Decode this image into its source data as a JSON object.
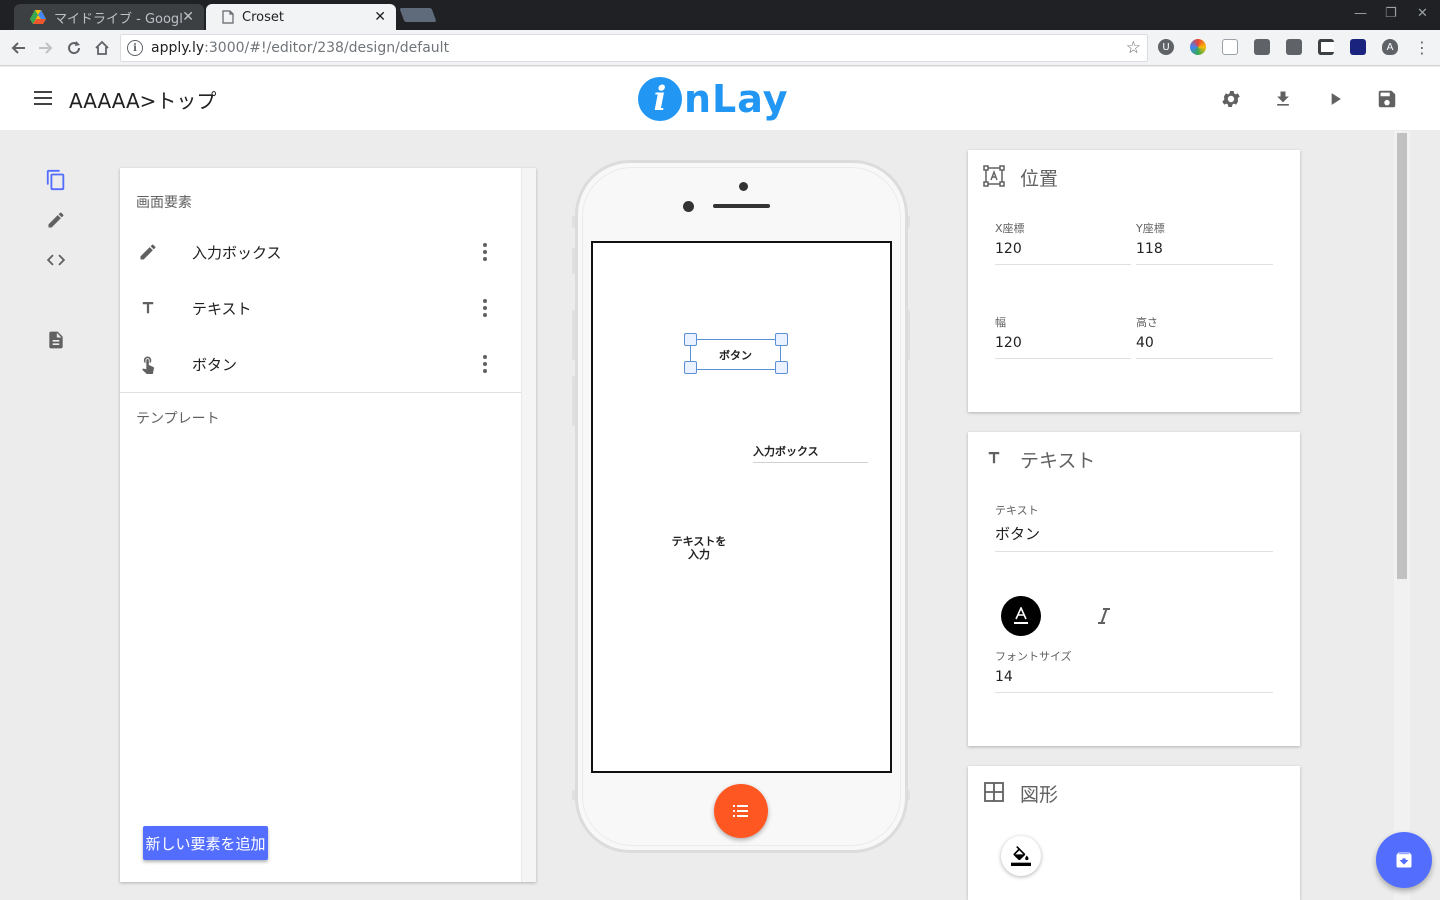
{
  "browser": {
    "tabs": [
      {
        "title": "マイドライブ - Google",
        "active": false,
        "icon": "google-drive-icon"
      },
      {
        "title": "Croset",
        "active": true,
        "icon": "document-icon"
      }
    ],
    "url": {
      "host": "apply.ly",
      "path": ":3000/#!/editor/238/design/default"
    },
    "accent": "#202124"
  },
  "header": {
    "title": "AAAAA>トップ",
    "logo": {
      "initial": "i",
      "rest": "nLay"
    },
    "actions": [
      "settings-icon",
      "download-icon",
      "play-icon",
      "save-icon"
    ]
  },
  "rail": {
    "items": [
      "pages-icon",
      "edit-icon",
      "code-icon",
      "document-icon"
    ]
  },
  "elements_panel": {
    "section_elements": "画面要素",
    "items": [
      {
        "label": "入力ボックス",
        "icon": "pencil-icon"
      },
      {
        "label": "テキスト",
        "icon": "text-icon"
      },
      {
        "label": "ボタン",
        "icon": "touch-icon"
      }
    ],
    "section_templates": "テンプレート",
    "add_button": "新しい要素を追加"
  },
  "canvas": {
    "button_label": "ボタン",
    "input_label": "入力ボックス",
    "text_label": "テキストを入力"
  },
  "position_card": {
    "title": "位置",
    "x_label": "X座標",
    "x_value": "120",
    "y_label": "Y座標",
    "y_value": "118",
    "w_label": "幅",
    "w_value": "120",
    "h_label": "高さ",
    "h_value": "40"
  },
  "text_card": {
    "title": "テキスト",
    "text_label": "テキスト",
    "text_value": "ボタン",
    "font_size_label": "フォントサイズ",
    "font_size_value": "14"
  },
  "shape_card": {
    "title": "図形"
  },
  "colors": {
    "brand": "#2196f3",
    "accent_button": "#536dfe",
    "fab": "#ff5722"
  }
}
